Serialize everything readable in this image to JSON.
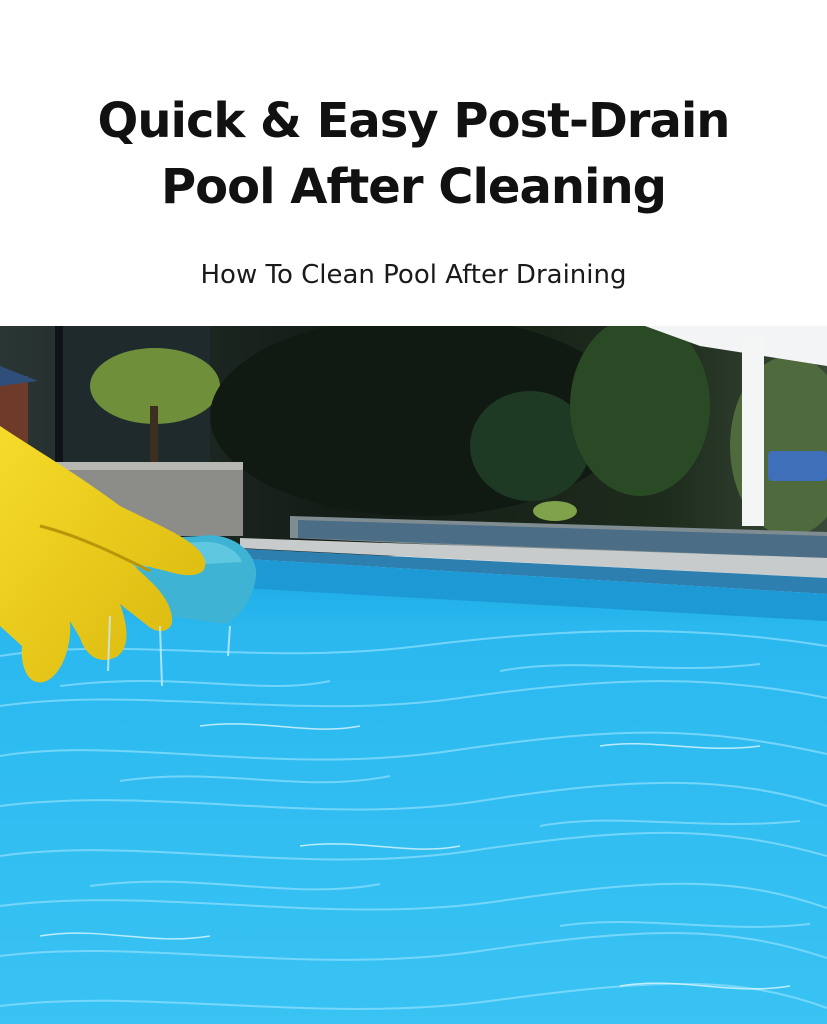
{
  "header": {
    "title_line1": "Quick & Easy Post-Drain",
    "title_line2": "Pool After Cleaning",
    "subtitle": "How To Clean Pool After Draining"
  },
  "photo": {
    "scene": "pool-with-gloved-hand-and-sponge",
    "colors": {
      "water": "#22b2ea",
      "water_light": "#63d3fb",
      "foliage": "#16241a",
      "glove": "#f0d21a",
      "sponge": "#3fb6d6",
      "coping": "#bfc3c4"
    }
  }
}
